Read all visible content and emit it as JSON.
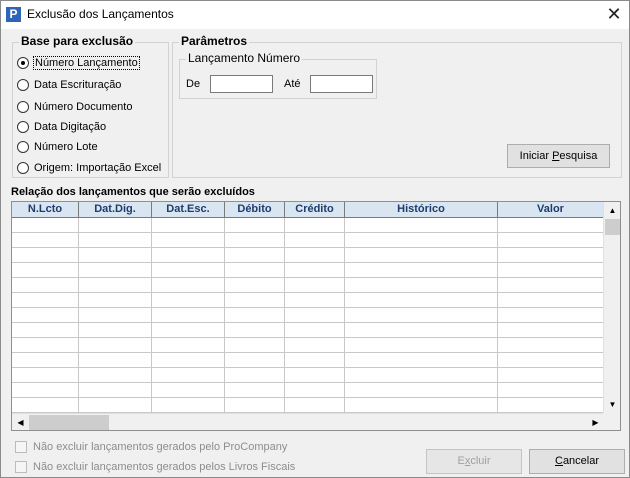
{
  "window": {
    "title": "Exclusão dos Lançamentos",
    "icon_letter": "P",
    "close_glyph": "✕"
  },
  "base": {
    "title": "Base para exclusão",
    "options": [
      {
        "label": "Número Lançamento",
        "checked": true
      },
      {
        "label": "Data Escrituração",
        "checked": false
      },
      {
        "label": "Número Documento",
        "checked": false
      },
      {
        "label": "Data Digitação",
        "checked": false
      },
      {
        "label": "Número Lote",
        "checked": false
      },
      {
        "label": "Origem: Importação Excel",
        "checked": false
      }
    ]
  },
  "params": {
    "title": "Parâmetros",
    "inner_title": "Lançamento Número",
    "from_label": "De",
    "from_value": "",
    "to_label": "Até",
    "to_value": "",
    "search_button": {
      "prefix": "Iniciar ",
      "mnemonic": "P",
      "suffix": "esquisa"
    }
  },
  "relation": {
    "title": "Relação dos lançamentos que serão excluídos",
    "columns": [
      "N.Lcto",
      "Dat.Dig.",
      "Dat.Esc.",
      "Débito",
      "Crédito",
      "Histórico",
      "Valor"
    ],
    "rows": [
      [
        "",
        "",
        "",
        "",
        "",
        "",
        ""
      ],
      [
        "",
        "",
        "",
        "",
        "",
        "",
        ""
      ],
      [
        "",
        "",
        "",
        "",
        "",
        "",
        ""
      ],
      [
        "",
        "",
        "",
        "",
        "",
        "",
        ""
      ],
      [
        "",
        "",
        "",
        "",
        "",
        "",
        ""
      ],
      [
        "",
        "",
        "",
        "",
        "",
        "",
        ""
      ],
      [
        "",
        "",
        "",
        "",
        "",
        "",
        ""
      ],
      [
        "",
        "",
        "",
        "",
        "",
        "",
        ""
      ],
      [
        "",
        "",
        "",
        "",
        "",
        "",
        ""
      ],
      [
        "",
        "",
        "",
        "",
        "",
        "",
        ""
      ],
      [
        "",
        "",
        "",
        "",
        "",
        "",
        ""
      ],
      [
        "",
        "",
        "",
        "",
        "",
        "",
        ""
      ],
      [
        "",
        "",
        "",
        "",
        "",
        "",
        ""
      ]
    ]
  },
  "options": {
    "skip_procompany": {
      "label": "Não excluir lançamentos gerados pelo ProCompany",
      "checked": false,
      "enabled": false
    },
    "skip_livros": {
      "label": "Não excluir lançamentos gerados pelos Livros Fiscais",
      "checked": false,
      "enabled": false
    }
  },
  "buttons": {
    "excluir": {
      "prefix": "E",
      "mnemonic": "x",
      "suffix": "cluir",
      "enabled": false
    },
    "cancelar": {
      "prefix": "",
      "mnemonic": "C",
      "suffix": "ancelar",
      "enabled": true
    }
  }
}
